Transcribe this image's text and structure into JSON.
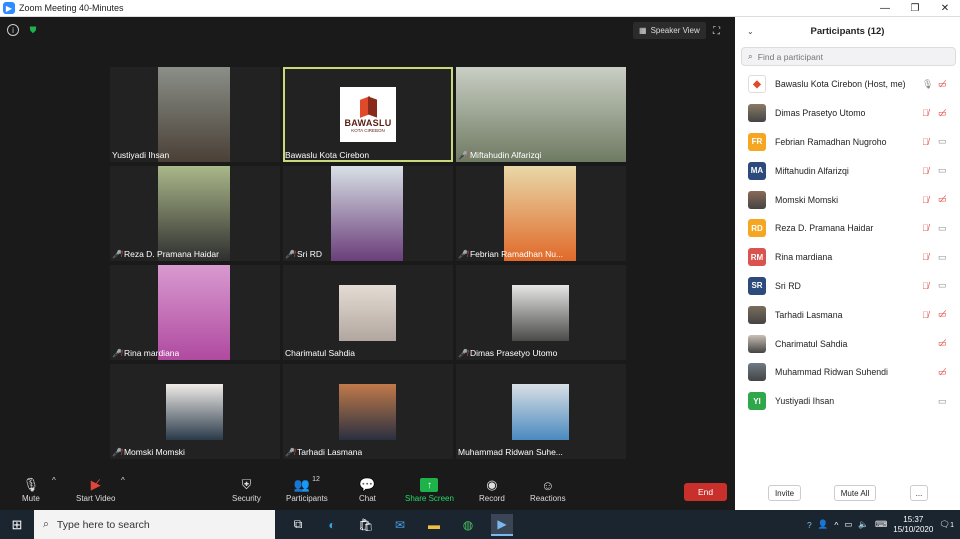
{
  "window": {
    "title": "Zoom Meeting 40-Minutes",
    "app_icon": "zoom-icon"
  },
  "top": {
    "speaker_view": "Speaker View"
  },
  "tiles": [
    {
      "name": "Yustiyadi Ihsan",
      "muted": false,
      "photo_color": "#6d6253"
    },
    {
      "name": "Bawaslu Kota Cirebon",
      "muted": false,
      "active": true,
      "logo": {
        "text": "BAWASLU",
        "sub": "KOTA CIREBON"
      }
    },
    {
      "name": "Miftahudin Alfarizqi",
      "muted": true,
      "photo_color": "#8d9880"
    },
    {
      "name": "Reza D. Pramana Haidar",
      "muted": true,
      "photo_color": "#5f7048"
    },
    {
      "name": "Sri RD",
      "muted": true,
      "photo_color": "#7c5c74"
    },
    {
      "name": "Febrian Ramadhan Nu...",
      "muted": true,
      "photo_color": "#c08050"
    },
    {
      "name": "Rina mardiana",
      "muted": true,
      "photo_color": "#c87ab8"
    },
    {
      "name": "Charimatul Sahdia",
      "muted": false,
      "photo_color": "#c9bfb5"
    },
    {
      "name": "Dimas Prasetyo Utomo",
      "muted": true,
      "photo_color": "#6f6a60"
    },
    {
      "name": "Momski Momski",
      "muted": true,
      "photo_color": "#b7a49a"
    },
    {
      "name": "Tarhadi Lasmana",
      "muted": true,
      "photo_color": "#7b6d5c"
    },
    {
      "name": "Muhammad Ridwan Suhe...",
      "muted": false,
      "photo_color": "#9aa7b0"
    }
  ],
  "toolbar": {
    "mute": "Mute",
    "start_video": "Start Video",
    "security": "Security",
    "participants": "Participants",
    "participants_count": "12",
    "chat": "Chat",
    "share_screen": "Share Screen",
    "record": "Record",
    "reactions": "Reactions",
    "end": "End"
  },
  "panel": {
    "title": "Participants (12)",
    "search_placeholder": "Find a participant",
    "participants": [
      {
        "name": "Bawaslu Kota Cirebon (Host, me)",
        "initials": "",
        "color": "#ffffff",
        "mic_muted": false,
        "cam_off": true
      },
      {
        "name": "Dimas Prasetyo Utomo",
        "initials": "",
        "color": "#8a7a66",
        "mic_muted": true,
        "cam_off": true
      },
      {
        "name": "Febrian Ramadhan Nugroho",
        "initials": "FR",
        "color": "#f5a623",
        "mic_muted": true,
        "cam_off": false
      },
      {
        "name": "Miftahudin Alfarizqi",
        "initials": "MA",
        "color": "#2c4a7c",
        "mic_muted": true,
        "cam_off": false
      },
      {
        "name": "Momski Momski",
        "initials": "",
        "color": "#8a6a55",
        "mic_muted": true,
        "cam_off": true
      },
      {
        "name": "Reza D. Pramana Haidar",
        "initials": "RD",
        "color": "#f5a623",
        "mic_muted": true,
        "cam_off": false
      },
      {
        "name": "Rina mardiana",
        "initials": "RM",
        "color": "#d9534f",
        "mic_muted": true,
        "cam_off": false
      },
      {
        "name": "Sri RD",
        "initials": "SR",
        "color": "#2c4a7c",
        "mic_muted": true,
        "cam_off": false
      },
      {
        "name": "Tarhadi Lasmana",
        "initials": "",
        "color": "#7b6d5c",
        "mic_muted": true,
        "cam_off": true
      },
      {
        "name": "Charimatul Sahdia",
        "initials": "",
        "color": "#c9bfb5",
        "mic_muted": false,
        "cam_off": true
      },
      {
        "name": "Muhammad Ridwan Suhendi",
        "initials": "",
        "color": "#6f7a85",
        "mic_muted": false,
        "cam_off": true
      },
      {
        "name": "Yustiyadi Ihsan",
        "initials": "YI",
        "color": "#2ea84a",
        "mic_muted": false,
        "cam_off": false
      }
    ],
    "invite": "Invite",
    "mute_all": "Mute All",
    "more": "..."
  },
  "taskbar": {
    "search_placeholder": "Type here to search",
    "time": "15:37",
    "date": "15/10/2020",
    "notification_count": "1"
  }
}
